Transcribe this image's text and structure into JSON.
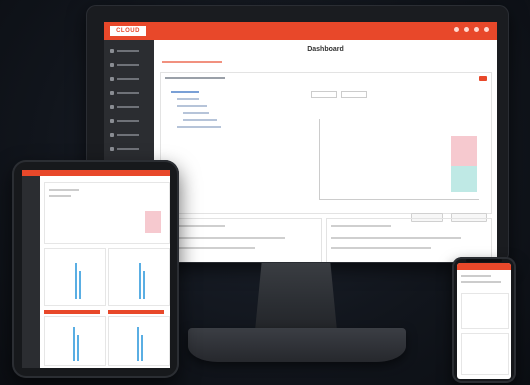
{
  "monitor": {
    "brand_logo": "CLOUD",
    "page_title": "Dashboard"
  },
  "colors": {
    "accent": "#e8482a",
    "sidebar": "#2b2d31",
    "background": "#11151c",
    "chart_pink": "#f6c9cf",
    "chart_teal": "#bfe9e5"
  },
  "icons": {
    "topbar": [
      "user-icon",
      "bell-icon",
      "settings-icon",
      "help-icon"
    ]
  }
}
